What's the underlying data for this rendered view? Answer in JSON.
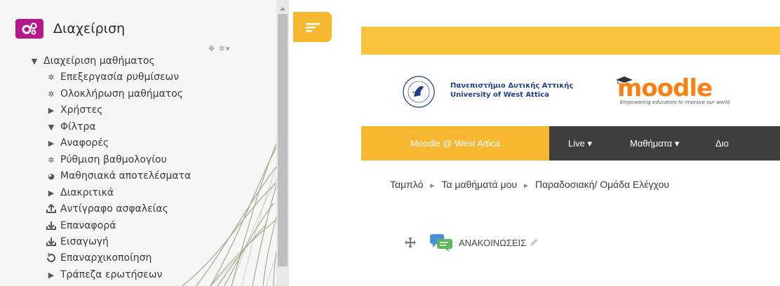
{
  "admin_block": {
    "title": "Διαχείριση",
    "controls_icon": "collapse-and-gear-icons",
    "items": [
      {
        "label": "Διαχείριση μαθήματος",
        "icon": "caret-down-icon"
      },
      {
        "label": "Επεξεργασία ρυθμίσεων",
        "icon": "gear-icon"
      },
      {
        "label": "Ολοκλήρωση μαθήματος",
        "icon": "gear-icon"
      },
      {
        "label": "Χρήστες",
        "icon": "caret-right-icon"
      },
      {
        "label": "Φίλτρα",
        "icon": "filter-icon"
      },
      {
        "label": "Αναφορές",
        "icon": "caret-right-icon"
      },
      {
        "label": "Ρύθμιση βαθμολογίου",
        "icon": "gear-icon"
      },
      {
        "label": "Μαθησιακά αποτελέσματα",
        "icon": "puzzle-icon"
      },
      {
        "label": "Διακριτικά",
        "icon": "caret-right-icon"
      },
      {
        "label": "Αντίγραφο ασφαλείας",
        "icon": "upload-icon"
      },
      {
        "label": "Επαναφορά",
        "icon": "download-icon"
      },
      {
        "label": "Εισαγωγή",
        "icon": "download-icon"
      },
      {
        "label": "Επαναρχικοποίηση",
        "icon": "reset-icon"
      },
      {
        "label": "Τράπεζα ερωτήσεων",
        "icon": "caret-right-icon"
      }
    ]
  },
  "header": {
    "university_gr": "Πανεπιστήμιο Δυτικής Αττικής",
    "university_en": "University of West Attica",
    "moodle_logo": "moodle",
    "moodle_tagline": "Empowering educators to improve our world"
  },
  "navbar": {
    "home": "Moodle @ West Attica",
    "items": [
      "Live ▾",
      "Μαθήματα ▾",
      "Διο"
    ]
  },
  "breadcrumb": {
    "items": [
      "Ταμπλό",
      "Τα μαθήματά μου",
      "Παραδοσιακή/ Ομάδα Ελέγχου"
    ],
    "separator": "►"
  },
  "section": {
    "title": "ΑΝΑΚΟΙΝΩΣΕΙΣ"
  },
  "colors": {
    "accent": "#f7b731",
    "brand_block": "#b6178a",
    "navbar": "#3b3f40",
    "moodle_orange": "#f98012"
  }
}
